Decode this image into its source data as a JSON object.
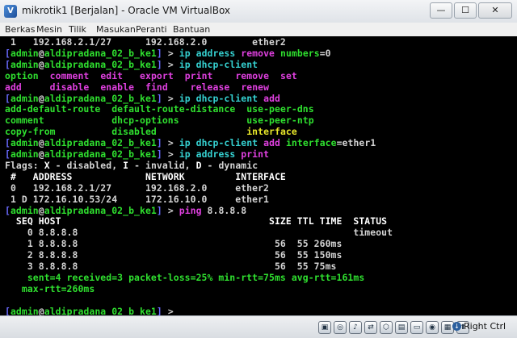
{
  "window": {
    "title": "mikrotik1 [Berjalan] - Oracle VM VirtualBox",
    "controls": [
      "—",
      "☐",
      "✕"
    ]
  },
  "menu": [
    "Berkas",
    "Mesin",
    "Tilik",
    "Masukan",
    "Peranti",
    "Bantuan"
  ],
  "terminal": {
    "lines": [
      [
        [
          "w",
          " 1   192.168.2.1/27      192.168.2.0        ether2"
        ]
      ],
      [
        [
          "b",
          "["
        ],
        [
          "g",
          "admin"
        ],
        [
          "w",
          "@"
        ],
        [
          "g",
          "aldipradana_02_b_ke1"
        ],
        [
          "b",
          "]"
        ],
        [
          "w",
          " > "
        ],
        [
          "c",
          "ip address"
        ],
        [
          "m",
          " remove"
        ],
        [
          "g",
          " numbers"
        ],
        [
          "w",
          "=0"
        ]
      ],
      [
        [
          "b",
          "["
        ],
        [
          "g",
          "admin"
        ],
        [
          "w",
          "@"
        ],
        [
          "g",
          "aldipradana_02_b_ke1"
        ],
        [
          "b",
          "]"
        ],
        [
          "w",
          " > "
        ],
        [
          "c",
          "ip dhcp-client"
        ]
      ],
      [
        [
          "g",
          "option"
        ],
        [
          "w",
          "  "
        ],
        [
          "m",
          "comment"
        ],
        [
          "w",
          "  "
        ],
        [
          "m",
          "edit"
        ],
        [
          "w",
          "   "
        ],
        [
          "m",
          "export"
        ],
        [
          "w",
          "  "
        ],
        [
          "m",
          "print"
        ],
        [
          "w",
          "    "
        ],
        [
          "m",
          "remove"
        ],
        [
          "w",
          "  "
        ],
        [
          "m",
          "set"
        ]
      ],
      [
        [
          "m",
          "add"
        ],
        [
          "w",
          "     "
        ],
        [
          "m",
          "disable"
        ],
        [
          "w",
          "  "
        ],
        [
          "m",
          "enable"
        ],
        [
          "w",
          "  "
        ],
        [
          "m",
          "find"
        ],
        [
          "w",
          "    "
        ],
        [
          "m",
          "release"
        ],
        [
          "w",
          "  "
        ],
        [
          "m",
          "renew"
        ]
      ],
      [
        [
          "b",
          "["
        ],
        [
          "g",
          "admin"
        ],
        [
          "w",
          "@"
        ],
        [
          "g",
          "aldipradana_02_b_ke1"
        ],
        [
          "b",
          "]"
        ],
        [
          "w",
          " > "
        ],
        [
          "c",
          "ip dhcp-client"
        ],
        [
          "m",
          " add"
        ]
      ],
      [
        [
          "g",
          "add-default-route"
        ],
        [
          "w",
          "  "
        ],
        [
          "g",
          "default-route-distance"
        ],
        [
          "w",
          "  "
        ],
        [
          "g",
          "use-peer-dns"
        ]
      ],
      [
        [
          "g",
          "comment"
        ],
        [
          "w",
          "            "
        ],
        [
          "g",
          "dhcp-options"
        ],
        [
          "w",
          "            "
        ],
        [
          "g",
          "use-peer-ntp"
        ]
      ],
      [
        [
          "g",
          "copy-from"
        ],
        [
          "w",
          "          "
        ],
        [
          "g",
          "disabled"
        ],
        [
          "w",
          "                "
        ],
        [
          "y",
          "interface"
        ]
      ],
      [
        [
          "b",
          "["
        ],
        [
          "g",
          "admin"
        ],
        [
          "w",
          "@"
        ],
        [
          "g",
          "aldipradana_02_b_ke1"
        ],
        [
          "b",
          "]"
        ],
        [
          "w",
          " > "
        ],
        [
          "c",
          "ip dhcp-client"
        ],
        [
          "m",
          " add"
        ],
        [
          "g",
          " interface"
        ],
        [
          "w",
          "=ether1"
        ]
      ],
      [
        [
          "b",
          "["
        ],
        [
          "g",
          "admin"
        ],
        [
          "w",
          "@"
        ],
        [
          "g",
          "aldipradana_02_b_ke1"
        ],
        [
          "b",
          "]"
        ],
        [
          "w",
          " > "
        ],
        [
          "c",
          "ip address"
        ],
        [
          "m",
          " print"
        ]
      ],
      [
        [
          "w",
          "Flags: "
        ],
        [
          "ww",
          "X"
        ],
        [
          "w",
          " - disabled, "
        ],
        [
          "ww",
          "I"
        ],
        [
          "w",
          " - invalid, "
        ],
        [
          "ww",
          "D"
        ],
        [
          "w",
          " - dynamic"
        ]
      ],
      [
        [
          "ww",
          " #   ADDRESS             NETWORK         INTERFACE"
        ]
      ],
      [
        [
          "w",
          " 0   192.168.2.1/27      192.168.2.0     ether2"
        ]
      ],
      [
        [
          "w",
          " 1 D 172.16.10.53/24     172.16.10.0     ether1"
        ]
      ],
      [
        [
          "b",
          "["
        ],
        [
          "g",
          "admin"
        ],
        [
          "w",
          "@"
        ],
        [
          "g",
          "aldipradana_02_b_ke1"
        ],
        [
          "b",
          "]"
        ],
        [
          "w",
          " > "
        ],
        [
          "m",
          "ping"
        ],
        [
          "w",
          " 8.8.8.8"
        ]
      ],
      [
        [
          "ww",
          "  SEQ HOST                                     SIZE TTL TIME  STATUS"
        ]
      ],
      [
        [
          "w",
          "    0 8.8.8.8                                                 timeout"
        ]
      ],
      [
        [
          "w",
          "    1 8.8.8.8                                   56  55 260ms"
        ]
      ],
      [
        [
          "w",
          "    2 8.8.8.8                                   56  55 150ms"
        ]
      ],
      [
        [
          "w",
          "    3 8.8.8.8                                   56  55 75ms"
        ]
      ],
      [
        [
          "g",
          "    sent=4 received=3 packet-loss=25% min-rtt=75ms avg-rtt=161ms"
        ]
      ],
      [
        [
          "g",
          "   max-rtt=260ms"
        ]
      ],
      [
        [
          "w",
          ""
        ]
      ],
      [
        [
          "b",
          "["
        ],
        [
          "g",
          "admin"
        ],
        [
          "w",
          "@"
        ],
        [
          "g",
          "aldipradana_02_b_ke1"
        ],
        [
          "b",
          "]"
        ],
        [
          "w",
          " > _"
        ]
      ]
    ]
  },
  "statusbar": {
    "icons": [
      "hdd-icon",
      "optical-icon",
      "audio-icon",
      "network-icon",
      "usb-icon",
      "shared-folder-icon",
      "display-icon",
      "video-capture-icon",
      "cpu-icon",
      "mouse-icon"
    ],
    "hostkey": "Right Ctrl"
  }
}
